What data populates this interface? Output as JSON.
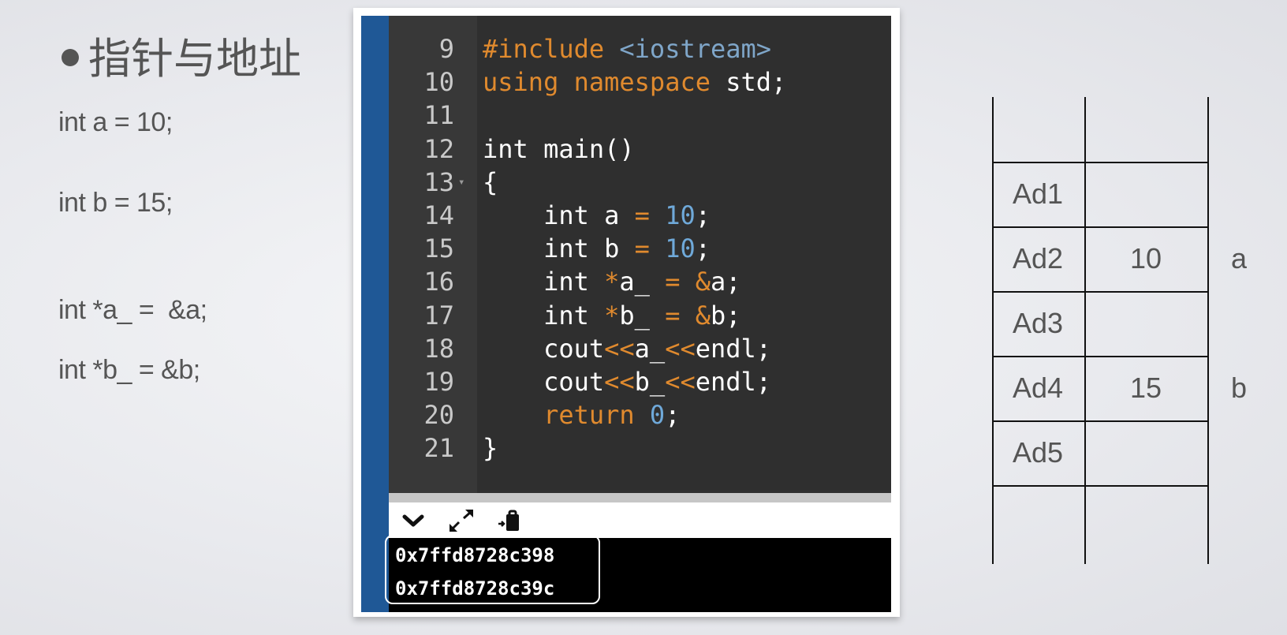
{
  "slide": {
    "title": "指针与地址",
    "lines": [
      "int a = 10;",
      "int b = 15;",
      "int *a_ =  &a;",
      "int *b_ = &b;"
    ]
  },
  "editor": {
    "lines": [
      {
        "num": "9",
        "code": "#include <iostream>"
      },
      {
        "num": "10",
        "code": "using namespace std;"
      },
      {
        "num": "11",
        "code": ""
      },
      {
        "num": "12",
        "code": "int main()"
      },
      {
        "num": "13",
        "code": "{"
      },
      {
        "num": "14",
        "code": "    int a = 10;"
      },
      {
        "num": "15",
        "code": "    int b = 10;"
      },
      {
        "num": "16",
        "code": "    int *a_ = &a;"
      },
      {
        "num": "17",
        "code": "    int *b_ = &b;"
      },
      {
        "num": "18",
        "code": "    cout<<a_<<endl;"
      },
      {
        "num": "19",
        "code": "    cout<<b_<<endl;"
      },
      {
        "num": "20",
        "code": "    return 0;"
      },
      {
        "num": "21",
        "code": "}"
      }
    ],
    "colors": {
      "background": "#2f2f2f",
      "keyword": "#e08a2e",
      "number": "#6fa9d9",
      "include_path": "#7fa6c9",
      "sidebar": "#1f5896"
    }
  },
  "toolbar": {
    "icons": [
      "chevron-down-icon",
      "expand-icon",
      "clipboard-icon"
    ]
  },
  "console": {
    "output": [
      "0x7ffd8728c398",
      "0x7ffd8728c39c"
    ]
  },
  "memory_table": {
    "rows": [
      {
        "address": "",
        "value": "",
        "label": ""
      },
      {
        "address": "Ad1",
        "value": "",
        "label": ""
      },
      {
        "address": "Ad2",
        "value": "10",
        "label": "a"
      },
      {
        "address": "Ad3",
        "value": "",
        "label": ""
      },
      {
        "address": "Ad4",
        "value": "15",
        "label": "b"
      },
      {
        "address": "Ad5",
        "value": "",
        "label": ""
      },
      {
        "address": "",
        "value": "",
        "label": ""
      }
    ]
  }
}
